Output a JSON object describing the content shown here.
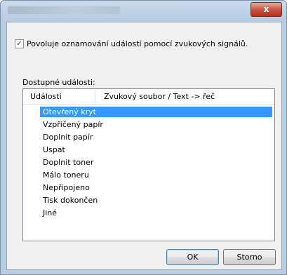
{
  "window": {
    "close_label": "x"
  },
  "options": {
    "enable_sound_checked": true,
    "enable_sound_label": "Povoluje oznamování událostí pomocí zvukových signálů."
  },
  "events": {
    "section_label": "Dostupné události:",
    "columns": [
      "Události",
      "Zvukový soubor / Text -> řeč"
    ],
    "items": [
      {
        "label": "Otevřený kryt",
        "selected": true
      },
      {
        "label": "Vzpříčený papír"
      },
      {
        "label": "Doplnit papír"
      },
      {
        "label": "Uspat"
      },
      {
        "label": "Doplnit toner"
      },
      {
        "label": "Málo toneru"
      },
      {
        "label": "Nepřipojeno"
      },
      {
        "label": "Tisk dokončen"
      },
      {
        "label": "Jiné"
      }
    ]
  },
  "buttons": {
    "ok": "OK",
    "cancel": "Storno"
  },
  "colors": {
    "selection": "#3399ff",
    "close": "#c7503a"
  }
}
